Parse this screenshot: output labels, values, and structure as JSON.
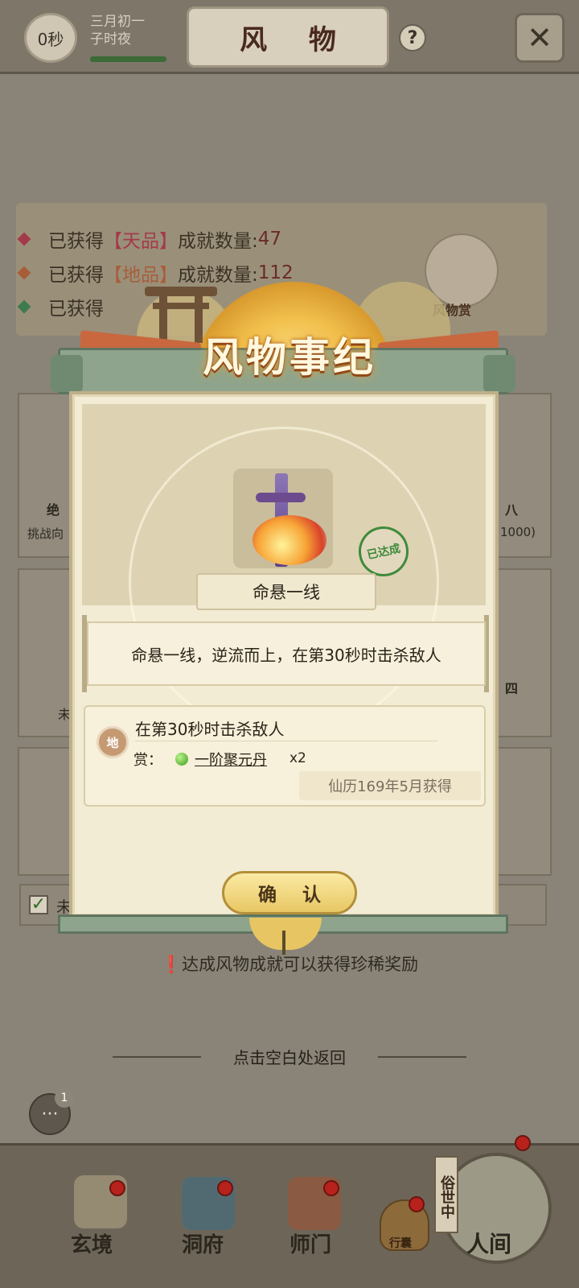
{
  "header": {
    "timer": "0秒",
    "date_line1": "三月初一",
    "date_line2": "子时夜",
    "title": "风 物",
    "help": "?",
    "close_icon": "crossed-swords-icon"
  },
  "stats": {
    "rows": [
      {
        "prefix": "已获得",
        "grade": "【天品】",
        "suffix": "成就数量:",
        "value": "47",
        "color": "#a33a4a"
      },
      {
        "prefix": "已获得",
        "grade": "【地品】",
        "suffix": "成就数量:",
        "value": "112",
        "color": "#a85d3a"
      },
      {
        "prefix": "已获得",
        "grade": "",
        "suffix": "",
        "value": "",
        "color": "#3f7a4f"
      }
    ],
    "mascot_label": "风物赏"
  },
  "background_peek": {
    "left_1": "绝",
    "left_1b": "挑战向",
    "right_1": "八",
    "right_1b": "1000)",
    "right_2": "四",
    "left_2": "未",
    "check_text": "未"
  },
  "modal": {
    "title": "风物事纪",
    "achievement_name": "命悬一线",
    "stamp": "已达成",
    "description": "命悬一线，逆流而上，在第30秒时击杀敌人",
    "grade_badge": "地",
    "condition": "在第30秒时击杀敌人",
    "reward_prefix": "赏：",
    "reward_item": "一阶聚元丹",
    "reward_qty": "x2",
    "obtained": "仙历169年5月获得",
    "confirm": "确 认"
  },
  "hint": "❗达成风物成就可以获得珍稀奖励",
  "back_hint": "点击空白处返回",
  "chat_badge": "1",
  "nav": {
    "items": [
      "玄境",
      "洞府",
      "师门",
      "人间"
    ],
    "bag_label": "行囊",
    "world_sign": "俗世中"
  }
}
